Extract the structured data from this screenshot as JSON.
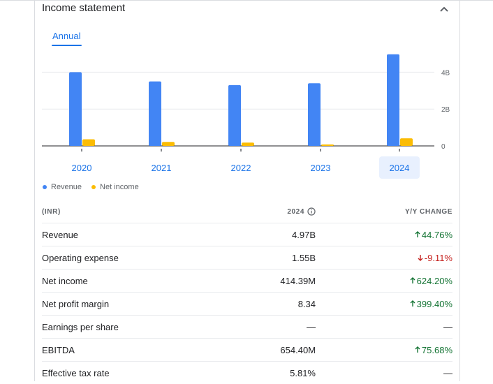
{
  "header": {
    "title": "Income statement"
  },
  "tabs": [
    {
      "label": "Annual"
    }
  ],
  "chart_data": {
    "type": "bar",
    "categories": [
      "2020",
      "2021",
      "2022",
      "2023",
      "2024"
    ],
    "series": [
      {
        "name": "Revenue",
        "color": "#4285f4",
        "values": [
          4.0,
          3.5,
          3.3,
          3.4,
          4.97
        ]
      },
      {
        "name": "Net income",
        "color": "#fbbc04",
        "values": [
          0.36,
          0.22,
          0.18,
          0.08,
          0.41
        ]
      }
    ],
    "y_ticks": [
      {
        "value": 0,
        "label": "0"
      },
      {
        "value": 2,
        "label": "2B"
      },
      {
        "value": 4,
        "label": "4B"
      }
    ],
    "ylim": [
      0,
      5
    ],
    "selected_category": "2024",
    "unit": "B"
  },
  "legend": {
    "revenue": "Revenue",
    "net_income": "Net income"
  },
  "table": {
    "headers": {
      "label": "(INR)",
      "year": "2024",
      "change": "Y/Y CHANGE"
    },
    "rows": [
      {
        "label": "Revenue",
        "value": "4.97B",
        "change": "44.76%",
        "direction": "up"
      },
      {
        "label": "Operating expense",
        "value": "1.55B",
        "change": "-9.11%",
        "direction": "down"
      },
      {
        "label": "Net income",
        "value": "414.39M",
        "change": "624.20%",
        "direction": "up"
      },
      {
        "label": "Net profit margin",
        "value": "8.34",
        "change": "399.40%",
        "direction": "up"
      },
      {
        "label": "Earnings per share",
        "value": "—",
        "change": "—",
        "direction": "none"
      },
      {
        "label": "EBITDA",
        "value": "654.40M",
        "change": "75.68%",
        "direction": "up"
      },
      {
        "label": "Effective tax rate",
        "value": "5.81%",
        "change": "—",
        "direction": "none"
      }
    ]
  },
  "colors": {
    "accent": "#1a73e8",
    "up": "#137333",
    "down": "#c5221f"
  }
}
